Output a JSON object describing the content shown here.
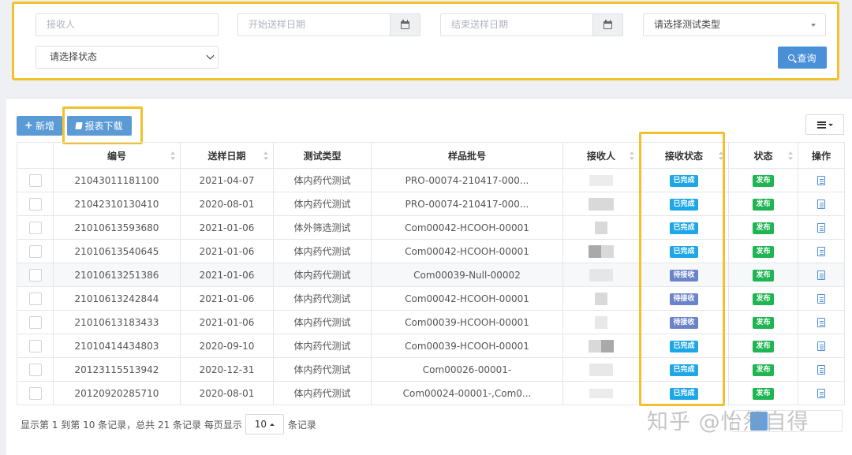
{
  "filters": {
    "receiver_placeholder": "接收人",
    "start_date_placeholder": "开始送样日期",
    "end_date_placeholder": "结束送样日期",
    "test_type_select": "请选择测试类型",
    "status_select": "请选择状态",
    "search_label": "查询"
  },
  "toolbar": {
    "add_label": "新增",
    "report_download_label": "报表下载"
  },
  "table": {
    "columns": [
      "编号",
      "送样日期",
      "测试类型",
      "样品批号",
      "接收人",
      "接收状态",
      "状态",
      "操作"
    ],
    "rows": [
      {
        "id": "21043011181100",
        "date": "2021-04-07",
        "type": "体内药代测试",
        "batch": "PRO-00074-210417-000...",
        "receive_status": "已完成",
        "status": "发布"
      },
      {
        "id": "21042310130410",
        "date": "2020-08-01",
        "type": "体内药代测试",
        "batch": "PRO-00074-210417-000...",
        "receive_status": "已完成",
        "status": "发布"
      },
      {
        "id": "21010613593680",
        "date": "2021-01-06",
        "type": "体外筛选测试",
        "batch": "Com00042-HCOOH-00001",
        "receive_status": "已完成",
        "status": "发布"
      },
      {
        "id": "21010613540645",
        "date": "2021-01-06",
        "type": "体内药代测试",
        "batch": "Com00042-HCOOH-00001",
        "receive_status": "已完成",
        "status": "发布"
      },
      {
        "id": "21010613251386",
        "date": "2021-01-06",
        "type": "体内药代测试",
        "batch": "Com00039-Null-00002",
        "receive_status": "待接收",
        "status": "发布"
      },
      {
        "id": "21010613242844",
        "date": "2021-01-06",
        "type": "体内药代测试",
        "batch": "Com00042-HCOOH-00001",
        "receive_status": "待接收",
        "status": "发布"
      },
      {
        "id": "21010613183433",
        "date": "2021-01-06",
        "type": "体内药代测试",
        "batch": "Com00039-HCOOH-00001",
        "receive_status": "待接收",
        "status": "发布"
      },
      {
        "id": "21010414434803",
        "date": "2020-09-10",
        "type": "体内药代测试",
        "batch": "Com00039-HCOOH-00001",
        "receive_status": "已完成",
        "status": "发布"
      },
      {
        "id": "20123115513942",
        "date": "2020-12-31",
        "type": "体内药代测试",
        "batch": "Com00026-00001-",
        "receive_status": "已完成",
        "status": "发布"
      },
      {
        "id": "20120920285710",
        "date": "2020-08-01",
        "type": "体内药代测试",
        "batch": "Com00024-00001-,Com0...",
        "receive_status": "已完成",
        "status": "发布"
      }
    ]
  },
  "pagination": {
    "summary": "显示第 1 到第 10 条记录，总共 21 条记录 每页显示",
    "page_size": "10",
    "suffix": "条记录"
  },
  "watermark": "知乎 @怡然自得",
  "colors": {
    "highlight": "#f3c12b",
    "primary": "#4a90d9",
    "badge_completed": "#1ea7e6",
    "badge_pending": "#6b84c9",
    "badge_published": "#1fb553"
  }
}
